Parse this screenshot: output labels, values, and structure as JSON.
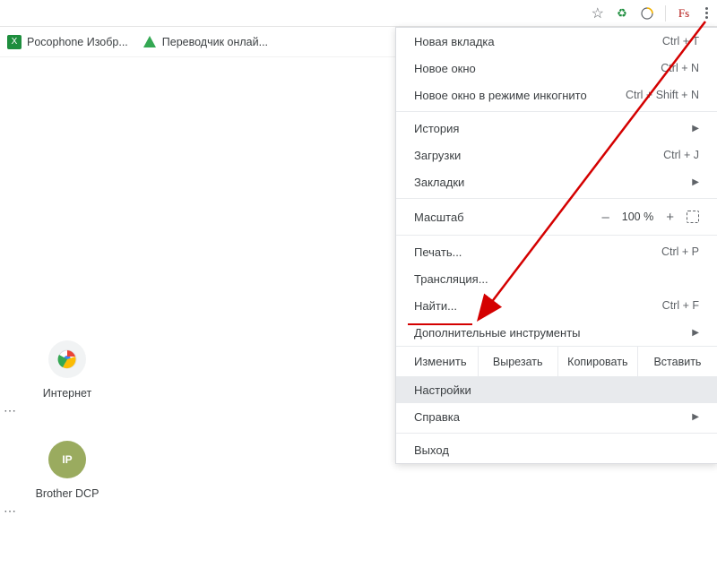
{
  "toolbar": {
    "star_title": "Добавить в закладки",
    "ext_recycle": "♻",
    "ext_round": "●",
    "ext_fs": "Fs",
    "more_title": "Настройка и управление"
  },
  "bookmarks": {
    "items": [
      {
        "label": "Pocophone Изобр...",
        "icon": "X",
        "iconClass": "green"
      },
      {
        "label": "Переводчик онлай...",
        "icon": "▼",
        "iconClass": "translate"
      }
    ]
  },
  "shortcuts": [
    {
      "label": "Интернет",
      "initials": "",
      "chrome": true
    },
    {
      "label": "Brother DCP",
      "initials": "IP",
      "bg": "#a0b56f"
    }
  ],
  "menu": {
    "new_tab": {
      "label": "Новая вкладка",
      "shortcut": "Ctrl + T"
    },
    "new_window": {
      "label": "Новое окно",
      "shortcut": "Ctrl + N"
    },
    "incognito": {
      "label": "Новое окно в режиме инкогнито",
      "shortcut": "Ctrl + Shift + N"
    },
    "history": {
      "label": "История"
    },
    "downloads": {
      "label": "Загрузки",
      "shortcut": "Ctrl + J"
    },
    "bookmarks": {
      "label": "Закладки"
    },
    "zoom": {
      "label": "Масштаб",
      "value": "100 %"
    },
    "print": {
      "label": "Печать...",
      "shortcut": "Ctrl + P"
    },
    "cast": {
      "label": "Трансляция..."
    },
    "find": {
      "label": "Найти...",
      "shortcut": "Ctrl + F"
    },
    "more_tools": {
      "label": "Дополнительные инструменты"
    },
    "edit": {
      "label": "Изменить",
      "cut": "Вырезать",
      "copy": "Копировать",
      "paste": "Вставить"
    },
    "settings": {
      "label": "Настройки"
    },
    "help": {
      "label": "Справка"
    },
    "exit": {
      "label": "Выход"
    }
  }
}
